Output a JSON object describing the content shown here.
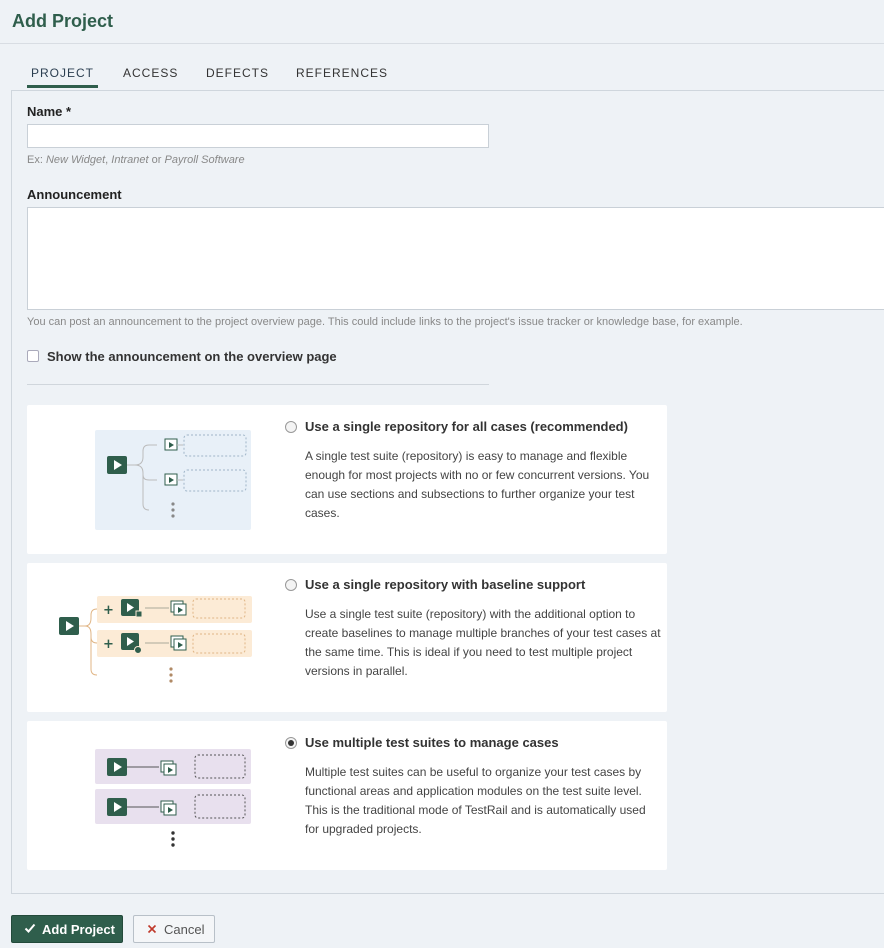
{
  "header": {
    "title": "Add Project"
  },
  "tabs": [
    {
      "label": "Project"
    },
    {
      "label": "Access"
    },
    {
      "label": "Defects"
    },
    {
      "label": "References"
    }
  ],
  "form": {
    "name_label": "Name *",
    "name_value": "",
    "name_hint_prefix": "Ex: ",
    "name_hint_ex1": "New Widget",
    "name_hint_sep1": ", ",
    "name_hint_ex2": "Intranet",
    "name_hint_sep2": " or ",
    "name_hint_ex3": "Payroll Software",
    "announcement_label": "Announcement",
    "announcement_value": "",
    "announcement_hint": "You can post an announcement to the project overview page. This could include links to the project's issue tracker or knowledge base, for example.",
    "show_announcement_label": "Show the announcement on the overview page",
    "show_announcement_checked": false
  },
  "suite_modes": [
    {
      "title": "Use a single repository for all cases (recommended)",
      "description": "A single test suite (repository) is easy to manage and flexible enough for most projects with no or few concurrent versions. You can use sections and subsections to further organize your test cases.",
      "selected": false
    },
    {
      "title": "Use a single repository with baseline support",
      "description": "Use a single test suite (repository) with the additional option to create baselines to manage multiple branches of your test cases at the same time. This is ideal if you need to test multiple project versions in parallel.",
      "selected": false
    },
    {
      "title": "Use multiple test suites to manage cases",
      "description": "Multiple test suites can be useful to organize your test cases by functional areas and application modules on the test suite level. This is the traditional mode of TestRail and is automatically used for upgraded projects.",
      "selected": true
    }
  ],
  "actions": {
    "submit_label": "Add Project",
    "cancel_label": "Cancel"
  },
  "colors": {
    "brand_green": "#2f5e4c",
    "illus_blue_bg": "#e8f0f8",
    "illus_orange_bg": "#fcebd6",
    "illus_purple_bg": "#e8e0ee"
  }
}
